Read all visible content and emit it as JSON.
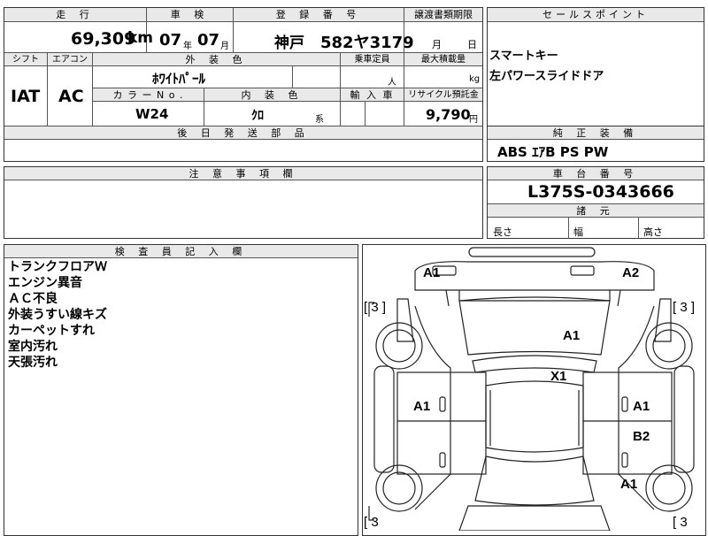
{
  "top": {
    "mileage_label": "走 行",
    "mileage_value": "69,309",
    "mileage_unit": "km",
    "inspection_label": "車 検",
    "inspection_year": "07",
    "year_unit": "年",
    "inspection_month": "07",
    "month_unit": "月",
    "registration_label": "登 録 番 号",
    "plate_region": "神戸",
    "plate_number": "582ヤ3179",
    "transfer_label": "譲渡書類期限",
    "transfer_month_unit": "月",
    "transfer_day_unit": "日"
  },
  "row2": {
    "shift_label": "シフト",
    "aircon_label": "エアコン",
    "shift_value": "IAT",
    "aircon_value": "AC",
    "exterior_label": "外 装 色",
    "exterior_value": "ﾎﾜｲﾄﾊﾟｰﾙ",
    "capacity_label": "乗車定員",
    "capacity_unit": "人",
    "maxload_label": "最大積載量",
    "maxload_unit": "kg",
    "color_no_label": "カ ラ ー N o .",
    "color_no_value": "W24",
    "interior_label": "内 装 色",
    "interior_value": "ｸﾛ",
    "interior_suffix": "系",
    "import_label": "輸 入 車",
    "recycle_label": "リサイクル預託金",
    "recycle_value": "9,790",
    "recycle_unit": "円"
  },
  "later_parts_label": "後 日 発 送 部 品",
  "sales": {
    "label": "セールスポイント",
    "lines": [
      "スマートキー",
      "左パワースライドドア"
    ]
  },
  "equipment": {
    "label": "純 正 装 備",
    "value": "ABS ｴｱB PS PW"
  },
  "caution_label": "注 意 事 項 欄",
  "chassis": {
    "label": "車 台 番 号",
    "value": "L375S-0343666"
  },
  "dims": {
    "label": "諸 元",
    "length": "長さ",
    "width": "幅",
    "height": "高さ"
  },
  "inspector": {
    "label": "検 査 員 記 入 欄",
    "notes": [
      "トランクフロアＷ",
      "エンジン異音",
      "ＡＣ不良",
      "外装うすい線キズ",
      "カーペットすれ",
      "室内汚れ",
      "天張汚れ"
    ]
  },
  "diagram_marks": {
    "a1_front_left": "A1",
    "a2_front_right": "A2",
    "tire_fl": "[ 3 ]",
    "tire_fr": "[ 3 ]",
    "hood": "A1",
    "roof": "X1",
    "left_door": "A1",
    "right_front_door": "A1",
    "right_rear_door": "B2",
    "right_rear": "A1",
    "tire_rl": "[ 3",
    "tire_rr": "[ 3"
  }
}
